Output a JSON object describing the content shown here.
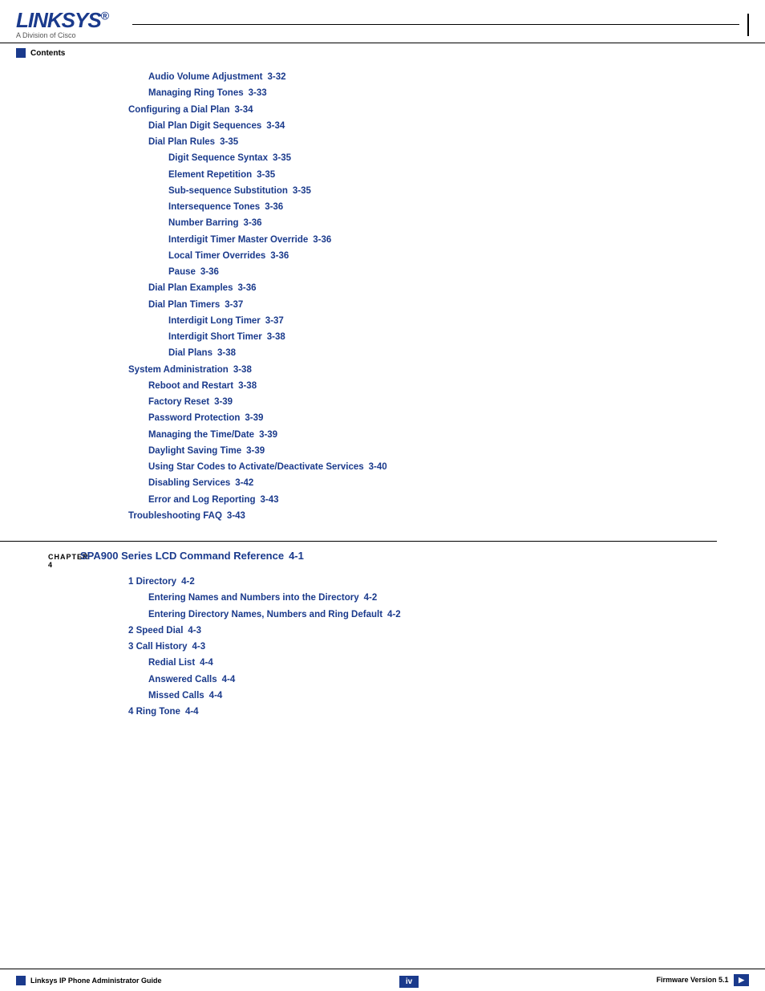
{
  "header": {
    "logo": "LINKSYS",
    "logo_reg": "®",
    "logo_sub": "A Division of Cisco",
    "contents_label": "Contents"
  },
  "toc": {
    "entries": [
      {
        "indent": 1,
        "label": "Audio Volume Adjustment",
        "page": "3-32"
      },
      {
        "indent": 1,
        "label": "Managing Ring Tones",
        "page": "3-33"
      },
      {
        "indent": 0,
        "label": "Configuring a Dial Plan",
        "page": "3-34"
      },
      {
        "indent": 1,
        "label": "Dial Plan Digit Sequences",
        "page": "3-34"
      },
      {
        "indent": 1,
        "label": "Dial Plan Rules",
        "page": "3-35"
      },
      {
        "indent": 2,
        "label": "Digit Sequence Syntax",
        "page": "3-35"
      },
      {
        "indent": 2,
        "label": "Element Repetition",
        "page": "3-35"
      },
      {
        "indent": 2,
        "label": "Sub-sequence Substitution",
        "page": "3-35"
      },
      {
        "indent": 2,
        "label": "Intersequence Tones",
        "page": "3-36"
      },
      {
        "indent": 2,
        "label": "Number Barring",
        "page": "3-36"
      },
      {
        "indent": 2,
        "label": "Interdigit Timer Master Override",
        "page": "3-36"
      },
      {
        "indent": 2,
        "label": "Local Timer Overrides",
        "page": "3-36"
      },
      {
        "indent": 2,
        "label": "Pause",
        "page": "3-36"
      },
      {
        "indent": 1,
        "label": "Dial Plan Examples",
        "page": "3-36"
      },
      {
        "indent": 1,
        "label": "Dial Plan Timers",
        "page": "3-37"
      },
      {
        "indent": 2,
        "label": "Interdigit Long Timer",
        "page": "3-37"
      },
      {
        "indent": 2,
        "label": "Interdigit Short Timer",
        "page": "3-38"
      },
      {
        "indent": 2,
        "label": "Dial Plans",
        "page": "3-38"
      },
      {
        "indent": 0,
        "label": "System Administration",
        "page": "3-38"
      },
      {
        "indent": 1,
        "label": "Reboot and Restart",
        "page": "3-38"
      },
      {
        "indent": 1,
        "label": "Factory Reset",
        "page": "3-39"
      },
      {
        "indent": 1,
        "label": "Password Protection",
        "page": "3-39"
      },
      {
        "indent": 1,
        "label": "Managing the Time/Date",
        "page": "3-39"
      },
      {
        "indent": 1,
        "label": "Daylight Saving Time",
        "page": "3-39"
      },
      {
        "indent": 1,
        "label": "Using Star Codes to Activate/Deactivate Services",
        "page": "3-40"
      },
      {
        "indent": 1,
        "label": "Disabling Services",
        "page": "3-42"
      },
      {
        "indent": 1,
        "label": "Error and Log Reporting",
        "page": "3-43"
      },
      {
        "indent": 0,
        "label": "Troubleshooting FAQ",
        "page": "3-43"
      }
    ]
  },
  "chapter4": {
    "label": "CHAPTER 4",
    "title": "SPA900 Series LCD Command Reference",
    "page": "4-1",
    "entries": [
      {
        "indent": 0,
        "label": "1 Directory",
        "page": "4-2"
      },
      {
        "indent": 1,
        "label": "Entering Names and Numbers into the Directory",
        "page": "4-2"
      },
      {
        "indent": 1,
        "label": "Entering Directory Names, Numbers and Ring Default",
        "page": "4-2"
      },
      {
        "indent": 0,
        "label": "2 Speed Dial",
        "page": "4-3"
      },
      {
        "indent": 0,
        "label": "3 Call History",
        "page": "4-3"
      },
      {
        "indent": 1,
        "label": "Redial List",
        "page": "4-4"
      },
      {
        "indent": 1,
        "label": "Answered Calls",
        "page": "4-4"
      },
      {
        "indent": 1,
        "label": "Missed Calls",
        "page": "4-4"
      },
      {
        "indent": 0,
        "label": "4 Ring Tone",
        "page": "4-4"
      }
    ]
  },
  "footer": {
    "title": "Linksys IP Phone Administrator Guide",
    "page": "iv",
    "version_label": "Firmware Version 5.1"
  }
}
